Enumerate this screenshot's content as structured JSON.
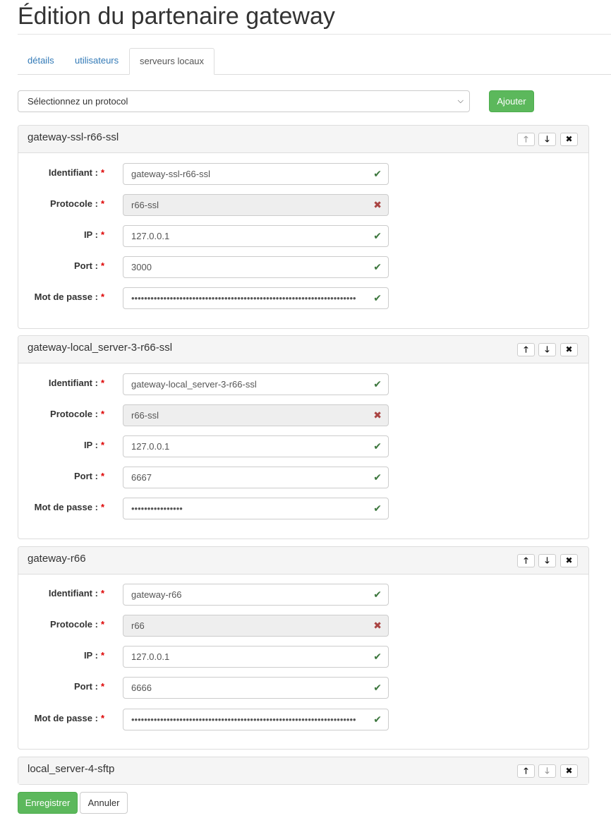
{
  "page": {
    "title": "Édition du partenaire gateway"
  },
  "tabs": [
    {
      "label": "détails",
      "active": false
    },
    {
      "label": "utilisateurs",
      "active": false
    },
    {
      "label": "serveurs locaux",
      "active": true
    }
  ],
  "toolbar": {
    "protocol_select_value": "Sélectionnez un protocol",
    "add_label": "Ajouter"
  },
  "icons": {
    "move_up": "arrow-up-icon",
    "move_down": "arrow-down-icon",
    "remove": "close-icon",
    "valid": "check-icon",
    "invalid": "cross-icon",
    "select_caret": "chevron-down-icon"
  },
  "glyphs": {
    "up": "🡑",
    "down": "🡓",
    "close": "✖",
    "check": "✔",
    "cross": "✖",
    "caret": "⌵"
  },
  "labels": {
    "identifiant": "Identifiant :",
    "protocole": "Protocole :",
    "ip": "IP :",
    "port": "Port :",
    "password": "Mot de passe :",
    "required": "*"
  },
  "servers": [
    {
      "title": "gateway-ssl-r66-ssl",
      "up_disabled": true,
      "down_disabled": false,
      "identifiant": "gateway-ssl-r66-ssl",
      "protocole": "r66-ssl",
      "ip": "127.0.0.1",
      "port": "3000",
      "password": "••••••••••••••••••••••••••••••••••••••••••••••••••••••••••••••••••••••"
    },
    {
      "title": "gateway-local_server-3-r66-ssl",
      "up_disabled": false,
      "down_disabled": false,
      "identifiant": "gateway-local_server-3-r66-ssl",
      "protocole": "r66-ssl",
      "ip": "127.0.0.1",
      "port": "6667",
      "password": "••••••••••••••••"
    },
    {
      "title": "gateway-r66",
      "up_disabled": false,
      "down_disabled": false,
      "identifiant": "gateway-r66",
      "protocole": "r66",
      "ip": "127.0.0.1",
      "port": "6666",
      "password": "••••••••••••••••••••••••••••••••••••••••••••••••••••••••••••••••••••••"
    },
    {
      "title": "local_server-4-sftp",
      "up_disabled": false,
      "down_disabled": true
    }
  ],
  "footer": {
    "save_label": "Enregistrer",
    "cancel_label": "Annuler"
  },
  "colors": {
    "success": "#5cb85c",
    "link": "#337ab7",
    "required": "#dd0000",
    "valid": "#3c763d",
    "invalid": "#a94442"
  }
}
